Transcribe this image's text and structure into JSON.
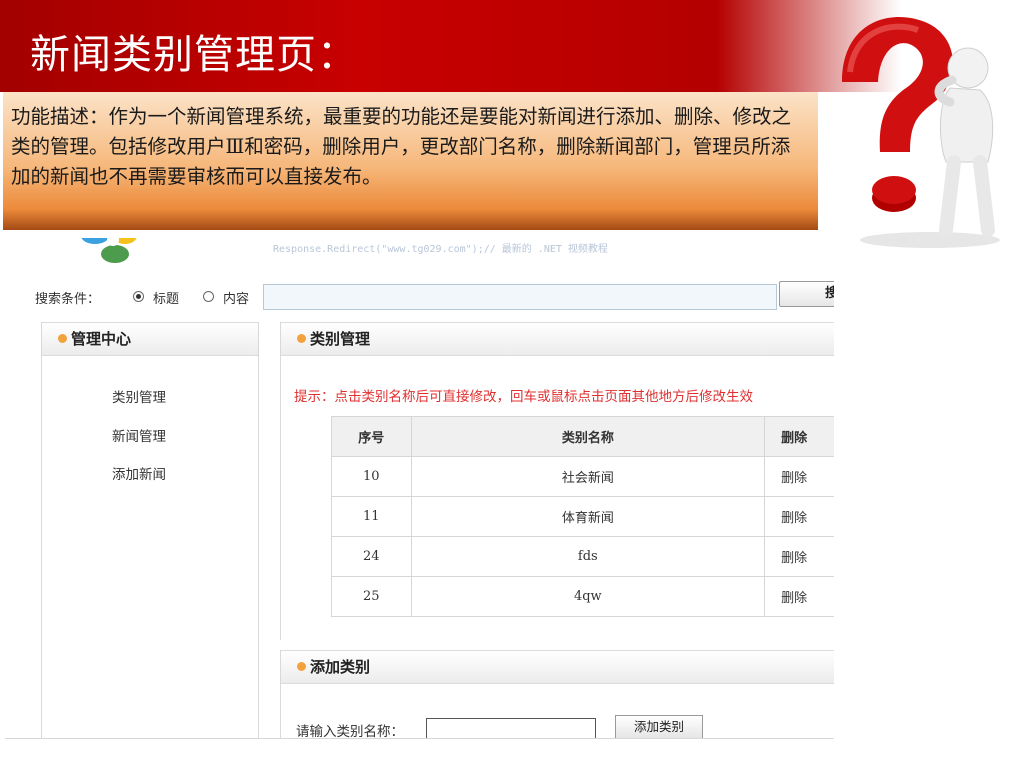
{
  "slide": {
    "title": "新闻类别管理页：",
    "description": "功能描述：作为一个新闻管理系统，最重要的功能还是要能对新闻进行添加、删除、修改之类的管理。包括修改用户Ⅲ和密码，删除用户，更改部门名称，删除新闻部门，管理员所添加的新闻也不再需要审核而可以直接发布。"
  },
  "colors": {
    "banner_red": "#c80000",
    "question_mark_red": "#d01010",
    "hint_red": "#e03030",
    "bullet_orange": "#f2a23c"
  },
  "icons": {
    "figure": "question-mark-person-icon",
    "logo": "flower-logo-icon"
  },
  "web": {
    "tagline": "Response.Redirect(\"www.tg029.com\");// 最新的 .NET 视频教程",
    "search": {
      "label": "搜索条件：",
      "option_title": "标题",
      "option_content": "内容",
      "selected": "标题",
      "value": "",
      "button": "搜"
    },
    "sidebar": {
      "title": "管理中心",
      "items": [
        "类别管理",
        "新闻管理",
        "添加新闻"
      ]
    },
    "category": {
      "title": "类别管理",
      "hint": "提示：点击类别名称后可直接修改，回车或鼠标点击页面其他地方后修改生效",
      "headers": [
        "序号",
        "类别名称",
        "删除"
      ],
      "rows": [
        {
          "id": "10",
          "name": "社会新闻",
          "del": "删除"
        },
        {
          "id": "11",
          "name": "体育新闻",
          "del": "删除"
        },
        {
          "id": "24",
          "name": "fds",
          "del": "删除"
        },
        {
          "id": "25",
          "name": "4qw",
          "del": "删除"
        }
      ]
    },
    "add": {
      "title": "添加类别",
      "label": "请输入类别名称：",
      "value": "",
      "button": "添加类别"
    }
  }
}
